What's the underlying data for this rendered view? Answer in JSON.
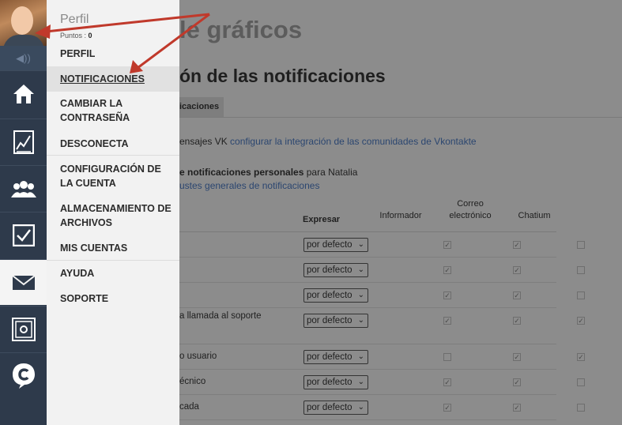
{
  "sidebar": {
    "icons": [
      "avatar",
      "speaker-icon",
      "home-icon",
      "chart-icon",
      "people-icon",
      "checkbox-icon",
      "mail-icon",
      "safe-icon",
      "chat-c-icon"
    ],
    "active_item": "mail-icon"
  },
  "menu": {
    "name": "Perfil",
    "points_label": "Puntos :",
    "points_value": "0",
    "items": [
      {
        "label": "PERFIL"
      },
      {
        "label": "NOTIFICACIONES"
      },
      {
        "label": "CAMBIAR LA CONTRASEÑA"
      },
      {
        "label": "DESCONECTA"
      },
      {
        "label": "CONFIGURACIÓN DE LA CUENTA"
      },
      {
        "label": "ALMACENAMIENTO DE ARCHIVOS"
      },
      {
        "label": "MIS CUENTAS"
      },
      {
        "label": "AYUDA"
      },
      {
        "label": "SOPORTE"
      }
    ]
  },
  "main": {
    "page_title": "le gráficos",
    "section_title": "ón de las notificaciones",
    "tab_label": "icaciones",
    "vk_prefix": "ensajes VK ",
    "vk_link": "configurar la integración de las comunidades de Vkontakte",
    "personal_bold": "e notificaciones personales",
    "personal_rest": " para Natalia",
    "general_link": "ustes generales de notificaciones",
    "columns": {
      "express": "Expresar",
      "informer": "Informador",
      "email": "Correo electrónico",
      "chatium": "Chatium"
    },
    "select_value": "por defecto",
    "rows": [
      {
        "label": "",
        "informer": true,
        "email": true,
        "chatium": false
      },
      {
        "label": "",
        "informer": true,
        "email": true,
        "chatium": false
      },
      {
        "label": "",
        "informer": true,
        "email": true,
        "chatium": false
      },
      {
        "label": "a llamada al soporte",
        "informer": true,
        "email": true,
        "chatium": true
      },
      {
        "label": "o usuario",
        "informer": false,
        "email": true,
        "chatium": true
      },
      {
        "label": "écnico",
        "informer": true,
        "email": true,
        "chatium": false
      },
      {
        "label": "cada",
        "informer": true,
        "email": true,
        "chatium": false
      }
    ]
  },
  "annotation_color": "#c0392b"
}
